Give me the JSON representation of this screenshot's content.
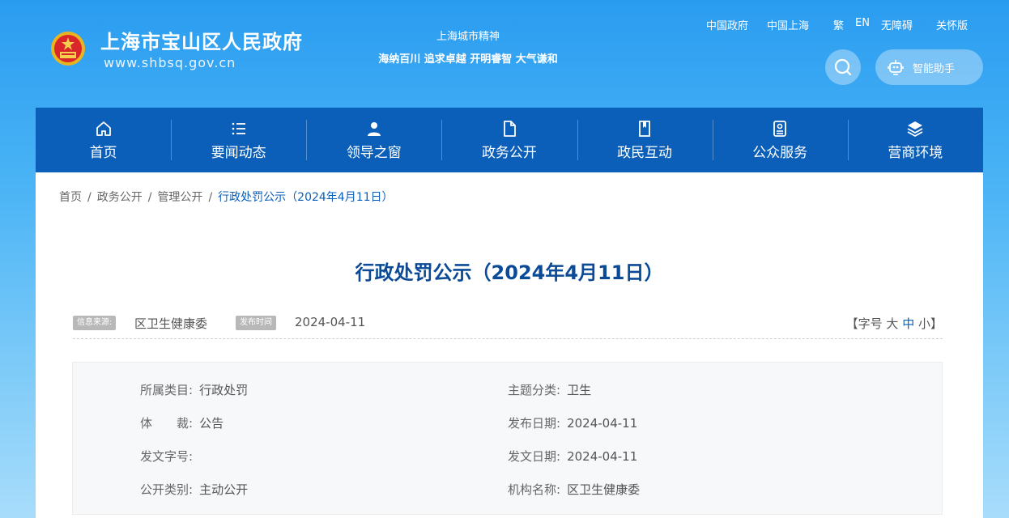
{
  "header": {
    "site_title": "上海市宝山区人民政府",
    "site_url": "www.shbsq.gov.cn",
    "spirit_title": "上海城市精神",
    "spirit_text": "海纳百川 追求卓越 开明睿智 大气谦和",
    "top_links": [
      "中国政府",
      "中国上海",
      "繁",
      "EN",
      "无障碍",
      "关怀版"
    ],
    "assistant_label": "智能助手"
  },
  "nav": {
    "items": [
      {
        "label": "首页",
        "icon": "home-icon"
      },
      {
        "label": "要闻动态",
        "icon": "list-icon"
      },
      {
        "label": "领导之窗",
        "icon": "user-icon"
      },
      {
        "label": "政务公开",
        "icon": "document-icon"
      },
      {
        "label": "政民互动",
        "icon": "book-icon"
      },
      {
        "label": "公众服务",
        "icon": "service-icon"
      },
      {
        "label": "营商环境",
        "icon": "layers-icon"
      }
    ]
  },
  "breadcrumb": {
    "items": [
      "首页",
      "政务公开",
      "管理公开"
    ],
    "separator": "/",
    "current": "行政处罚公示（2024年4月11日）"
  },
  "article": {
    "title": "行政处罚公示（2024年4月11日）",
    "source_label": "信息来源:",
    "source_value": "区卫生健康委",
    "time_label": "发布时间",
    "time_value": "2024-04-11",
    "font_open": "【字号",
    "font_large": "大",
    "font_medium": "中",
    "font_small": "小】"
  },
  "info": {
    "category_label": "所属类目:",
    "category_value": "行政处罚",
    "topic_label": "主题分类:",
    "topic_value": "卫生",
    "genre_label": "体　　裁:",
    "genre_value": "公告",
    "publish_label": "发布日期:",
    "publish_value": "2024-04-11",
    "docno_label": "发文字号:",
    "docno_value": "",
    "issue_label": "发文日期:",
    "issue_value": "2024-04-11",
    "open_label": "公开类别:",
    "open_value": "主动公开",
    "org_label": "机构名称:",
    "org_value": "区卫生健康委"
  },
  "colors": {
    "nav_bg": "#0b5fb8",
    "title": "#0b4a96",
    "accent": "#0b5fb8"
  }
}
